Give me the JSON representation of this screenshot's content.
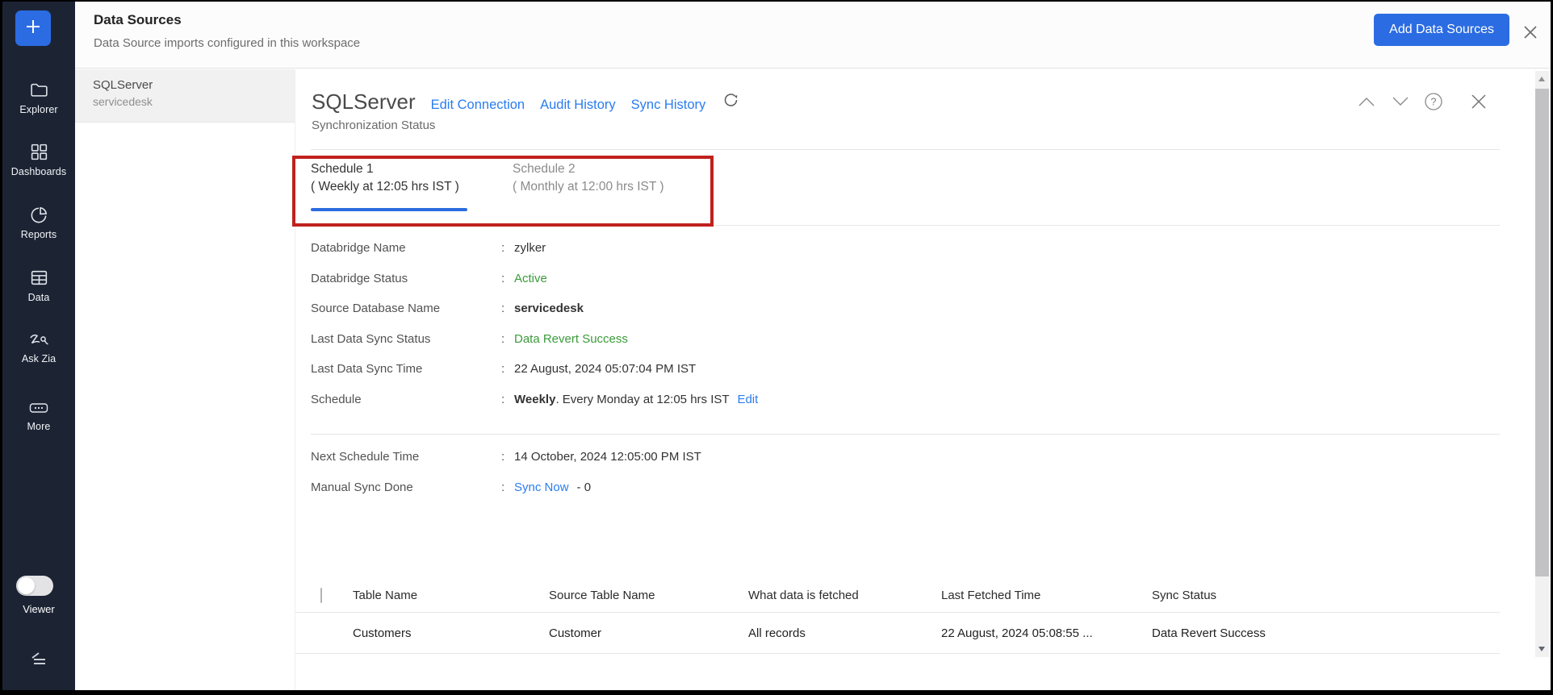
{
  "colors": {
    "sidebar_bg": "#1c2434",
    "accent_blue": "#2b6ce2",
    "link_blue": "#2a7cf0",
    "status_green": "#3a9b3a",
    "annotation_red": "#c0211d"
  },
  "sidebar": {
    "items": [
      {
        "label": "Explorer",
        "icon": "folder-icon"
      },
      {
        "label": "Dashboards",
        "icon": "grid-icon"
      },
      {
        "label": "Reports",
        "icon": "pie-chart-icon"
      },
      {
        "label": "Data",
        "icon": "table-icon"
      },
      {
        "label": "Ask Zia",
        "icon": "zia-icon"
      },
      {
        "label": "More",
        "icon": "ellipsis-icon"
      }
    ],
    "viewer_toggle_label": "Viewer"
  },
  "header": {
    "title": "Data Sources",
    "subtitle": "Data Source imports configured in this workspace",
    "add_button_label": "Add Data Sources"
  },
  "source_list": {
    "selected": {
      "name": "SQLServer",
      "database": "servicedesk"
    }
  },
  "panel": {
    "title": "SQLServer",
    "links": {
      "edit_connection": "Edit Connection",
      "audit_history": "Audit History",
      "sync_history": "Sync History"
    },
    "section_label": "Synchronization Status",
    "colon": ":",
    "tabs": [
      {
        "name": "Schedule 1",
        "schedule": "( Weekly at 12:05 hrs IST )"
      },
      {
        "name": "Schedule 2",
        "schedule": "( Monthly at 12:00 hrs IST )"
      }
    ],
    "details": [
      {
        "label": "Databridge Name",
        "value": "zylker"
      },
      {
        "label": "Databridge Status",
        "value": "Active"
      },
      {
        "label": "Source Database Name",
        "value": "servicedesk"
      },
      {
        "label": "Last Data Sync Status",
        "value": "Data Revert Success"
      },
      {
        "label": "Last Data Sync Time",
        "value": "22 August, 2024 05:07:04 PM IST"
      },
      {
        "label": "Schedule",
        "value_bold": "Weekly",
        "value_rest": ". Every Monday at 12:05 hrs IST",
        "edit_link": "Edit"
      }
    ],
    "details_secondary": [
      {
        "label": "Next Schedule Time",
        "value": "14 October, 2024 12:05:00 PM IST"
      },
      {
        "label": "Manual Sync Done",
        "link": "Sync Now",
        "suffix": "- 0"
      }
    ]
  },
  "table": {
    "columns": [
      "Table Name",
      "Source Table Name",
      "What data is fetched",
      "Last Fetched Time",
      "Sync Status"
    ],
    "rows": [
      [
        "Customers",
        "Customer",
        "All records",
        "22 August, 2024 05:08:55 ...",
        "Data Revert Success"
      ]
    ]
  }
}
